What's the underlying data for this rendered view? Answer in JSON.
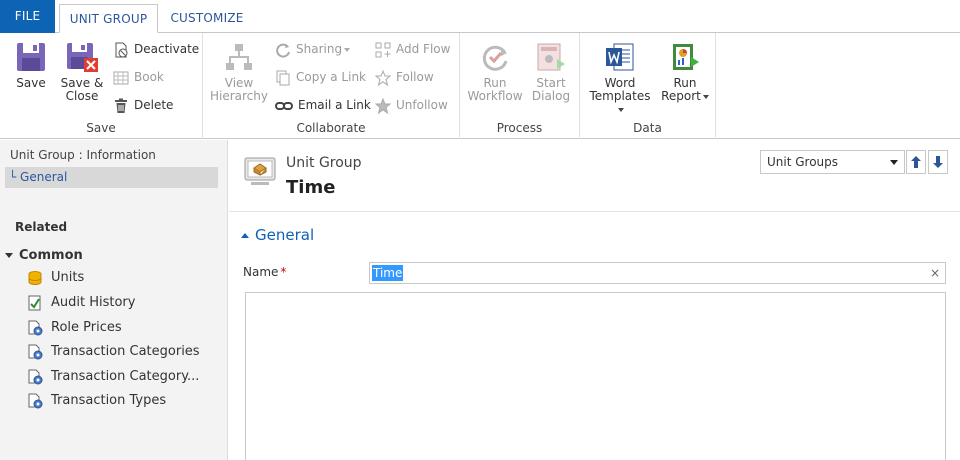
{
  "tabs": {
    "file": "FILE",
    "unit_group": "UNIT GROUP",
    "customize": "CUSTOMIZE"
  },
  "ribbon": {
    "save_group": {
      "label": "Save",
      "save": "Save",
      "save_close_1": "Save &",
      "save_close_2": "Close",
      "deactivate": "Deactivate",
      "book": "Book",
      "delete": "Delete"
    },
    "collaborate_group": {
      "label": "Collaborate",
      "view_hierarchy_1": "View",
      "view_hierarchy_2": "Hierarchy",
      "sharing": "Sharing",
      "copy_link": "Copy a Link",
      "email_link": "Email a Link",
      "add_flow": "Add Flow",
      "follow": "Follow",
      "unfollow": "Unfollow"
    },
    "process_group": {
      "label": "Process",
      "run_workflow_1": "Run",
      "run_workflow_2": "Workflow",
      "start_dialog_1": "Start",
      "start_dialog_2": "Dialog"
    },
    "data_group": {
      "label": "Data",
      "word_templates_1": "Word",
      "word_templates_2": "Templates",
      "run_report_1": "Run",
      "run_report_2": "Report"
    }
  },
  "leftnav": {
    "breadcrumb": "Unit Group : Information",
    "general": "└ General",
    "related": "Related",
    "common": "Common",
    "items": [
      {
        "label": "Units",
        "icon": "units-icon"
      },
      {
        "label": "Audit History",
        "icon": "audit-history-icon"
      },
      {
        "label": "Role Prices",
        "icon": "role-prices-icon"
      },
      {
        "label": "Transaction Categories",
        "icon": "transaction-categories-icon"
      },
      {
        "label": "Transaction Category...",
        "icon": "transaction-category-icon"
      },
      {
        "label": "Transaction Types",
        "icon": "transaction-types-icon"
      }
    ]
  },
  "main": {
    "entity_type": "Unit Group",
    "entity_name": "Time",
    "view_selector": "Unit Groups",
    "section_title": "General",
    "name_label": "Name",
    "required_mark": "*",
    "name_value": "Time",
    "clear_glyph": "×"
  },
  "colors": {
    "file_tab": "#0e64b4",
    "accent": "#2b579a",
    "section": "#1160b7",
    "selection": "#3399ff",
    "required": "#cc0000"
  }
}
